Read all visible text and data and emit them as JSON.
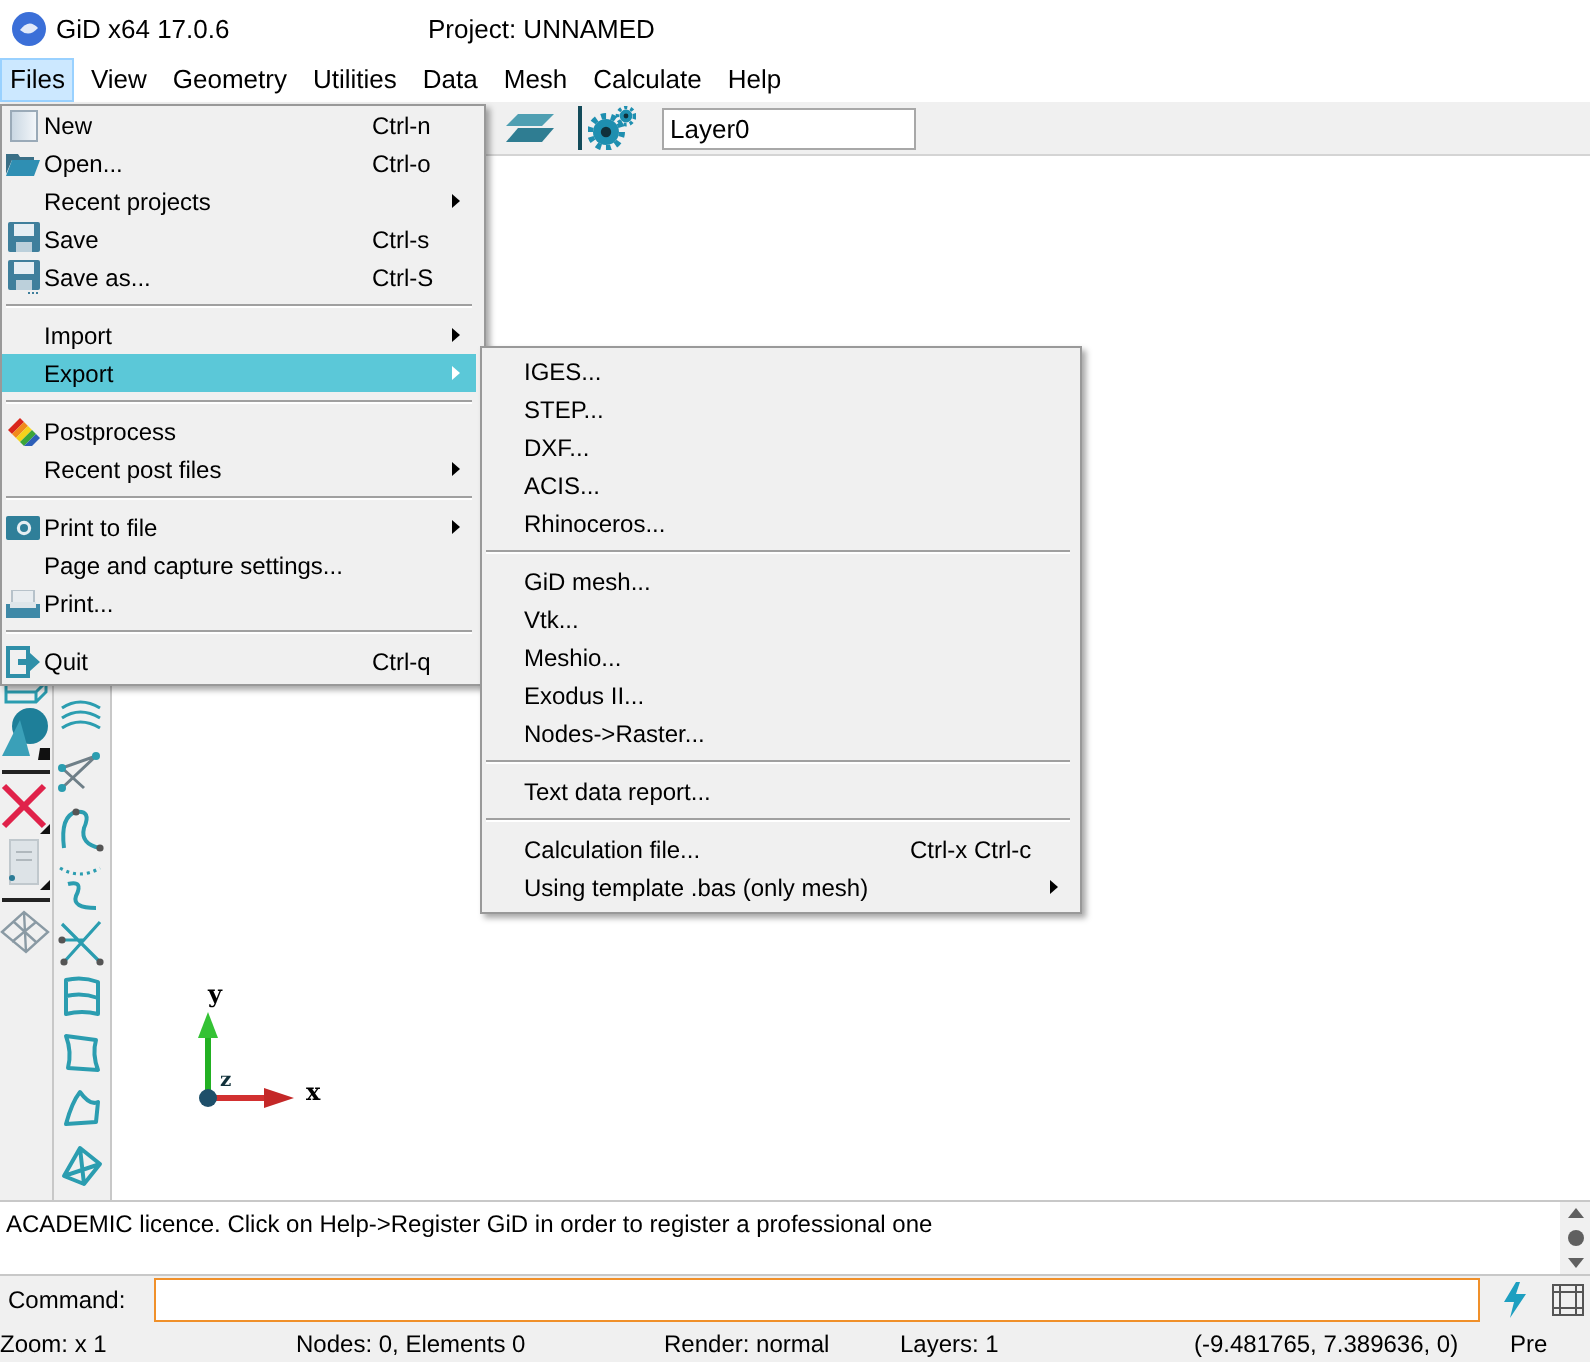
{
  "window": {
    "title": "GiD x64 17.0.6",
    "project": "Project: UNNAMED"
  },
  "menubar": [
    {
      "label": "Files",
      "selected": true
    },
    {
      "label": "View",
      "selected": false
    },
    {
      "label": "Geometry",
      "selected": false
    },
    {
      "label": "Utilities",
      "selected": false
    },
    {
      "label": "Data",
      "selected": false
    },
    {
      "label": "Mesh",
      "selected": false
    },
    {
      "label": "Calculate",
      "selected": false
    },
    {
      "label": "Help",
      "selected": false
    }
  ],
  "toolbar": {
    "layer_field": {
      "value": "Layer0"
    }
  },
  "files_menu": {
    "items": [
      {
        "kind": "command",
        "label": "New",
        "shortcut": "Ctrl-n",
        "selected": false
      },
      {
        "kind": "command",
        "label": "Open...",
        "shortcut": "Ctrl-o",
        "selected": false
      },
      {
        "kind": "submenu",
        "label": "Recent projects",
        "selected": false
      },
      {
        "kind": "command",
        "label": "Save",
        "shortcut": "Ctrl-s",
        "selected": false
      },
      {
        "kind": "command",
        "label": "Save as...",
        "shortcut": "Ctrl-S",
        "selected": false
      },
      {
        "kind": "separator"
      },
      {
        "kind": "submenu",
        "label": "Import",
        "selected": false
      },
      {
        "kind": "submenu",
        "label": "Export",
        "selected": true
      },
      {
        "kind": "separator"
      },
      {
        "kind": "command",
        "label": "Postprocess",
        "selected": false
      },
      {
        "kind": "submenu",
        "label": "Recent post files",
        "selected": false
      },
      {
        "kind": "separator"
      },
      {
        "kind": "submenu",
        "label": "Print to file",
        "selected": false
      },
      {
        "kind": "command",
        "label": "Page and capture settings...",
        "selected": false
      },
      {
        "kind": "command",
        "label": "Print...",
        "selected": false
      },
      {
        "kind": "separator"
      },
      {
        "kind": "command",
        "label": "Quit",
        "shortcut": "Ctrl-q",
        "selected": false
      }
    ]
  },
  "export_menu": {
    "items": [
      {
        "kind": "command",
        "label": "IGES...",
        "selected": false
      },
      {
        "kind": "command",
        "label": "STEP...",
        "selected": false
      },
      {
        "kind": "command",
        "label": "DXF...",
        "selected": false
      },
      {
        "kind": "command",
        "label": "ACIS...",
        "selected": false
      },
      {
        "kind": "command",
        "label": "Rhinoceros...",
        "selected": false
      },
      {
        "kind": "separator"
      },
      {
        "kind": "command",
        "label": "GiD mesh...",
        "selected": false
      },
      {
        "kind": "command",
        "label": "Vtk...",
        "selected": false
      },
      {
        "kind": "command",
        "label": "Meshio...",
        "selected": false
      },
      {
        "kind": "command",
        "label": "Exodus II...",
        "selected": false
      },
      {
        "kind": "command",
        "label": "Nodes->Raster...",
        "selected": false
      },
      {
        "kind": "separator"
      },
      {
        "kind": "command",
        "label": "Text data report...",
        "selected": false
      },
      {
        "kind": "separator"
      },
      {
        "kind": "command",
        "label": "Calculation file...",
        "shortcut": "Ctrl-x Ctrl-c",
        "selected": false
      },
      {
        "kind": "submenu",
        "label": "Using template .bas (only mesh)",
        "selected": false
      }
    ]
  },
  "canvas": {
    "axes": {
      "x_label": "x",
      "y_label": "y",
      "z_label": "z"
    }
  },
  "messages": {
    "lines": [
      "ACADEMIC licence. Click on Help->Register GiD in order to register a professional one"
    ]
  },
  "command": {
    "label": "Command:"
  },
  "status_bar": {
    "items": [
      "Zoom: x 1",
      "Nodes: 0, Elements 0",
      "Render: normal",
      "Layers: 1",
      "(-9.481765, 7.389636, 0)",
      "Pre"
    ]
  }
}
